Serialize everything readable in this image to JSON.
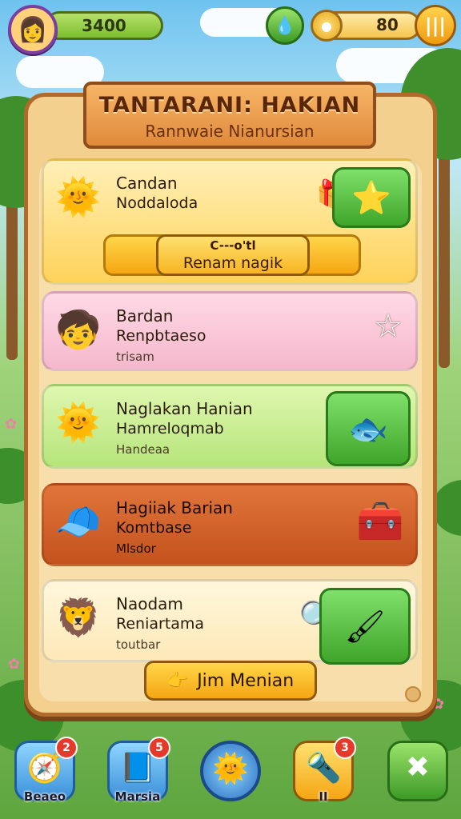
{
  "hud": {
    "avatar_icon": "👩",
    "score": "3400",
    "gem_icon": "💧",
    "coin_icon": "●",
    "coins": "80",
    "shop_icon": "|||"
  },
  "panel": {
    "title": "TANTARANI: HAKIAN",
    "subtitle": "Rannwaie Nianursian"
  },
  "cards": [
    {
      "icon": "🌞",
      "line1": "Candan",
      "line2": "Noddaloda",
      "side_icon": "🎁",
      "action_icon": "⭐",
      "button_top": "C---o'tl",
      "button_label": "Renam nagik"
    },
    {
      "icon": "🧒",
      "line1": "Bardan",
      "line2": "Renpbtaeso",
      "line3": "trisam",
      "action_icon": "☆"
    },
    {
      "icon": "🌞",
      "line1": "Naglakan Hanian",
      "line2": "Hamreloqmab",
      "line3": "Handeaa",
      "action_icon": "🐟"
    },
    {
      "icon": "🧢",
      "line1": "Hagiiak Barian",
      "line2": "Komtbase",
      "line3": "Mlsdor",
      "action_icon": "🧰"
    },
    {
      "icon": "🦁",
      "line1": "Naodam",
      "line2": "Reniartama",
      "line3": "toutbar",
      "side_icon": "🔍",
      "action_icon": "🖌"
    }
  ],
  "bottom_button": {
    "icon": "👉",
    "label": "Jim Menian"
  },
  "nav": [
    {
      "label": "Beaeo",
      "icon": "🧭",
      "badge": "2"
    },
    {
      "label": "Marsia",
      "icon": "📘",
      "badge": "5"
    },
    {
      "label": "",
      "icon": "🌞",
      "badge": ""
    },
    {
      "label": "II",
      "icon": "🔦",
      "badge": "3"
    },
    {
      "label": "",
      "icon": "✖",
      "badge": ""
    }
  ]
}
